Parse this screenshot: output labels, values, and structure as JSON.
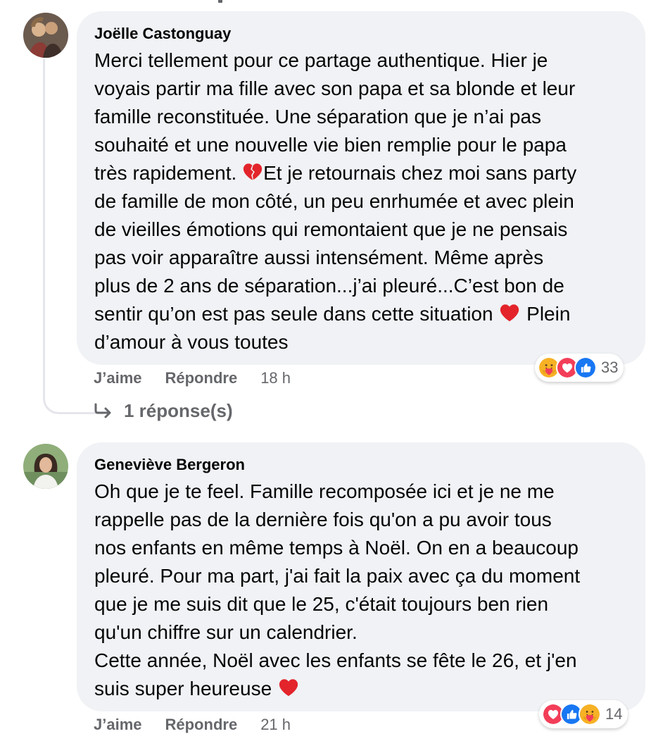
{
  "comments": [
    {
      "author": "Joëlle Castonguay",
      "text": [
        "Merci tellement pour ce partage authentique. Hier je",
        "voyais partir ma fille avec son papa et sa blonde et leur",
        "famille reconstituée. Une séparation que je n’ai pas",
        "souhaité et une nouvelle vie bien remplie pour le papa",
        "très rapidement. ",
        "Et je retournais chez moi sans party",
        "de famille de mon côté, un peu enrhumée et avec plein",
        "de vieilles émotions qui remontaient que je ne pensais",
        "pas voir apparaître aussi intensément. Même après",
        "plus de 2 ans de séparation...j’ai pleuré...C’est bon de",
        "sentir qu’on est pas seule dans cette situation ",
        " Plein",
        "d’amour à vous toutes"
      ],
      "reactions": {
        "icons": [
          "care-icon",
          "love-icon",
          "like-icon"
        ],
        "count": "33"
      },
      "like_label": "J’aime",
      "reply_label": "Répondre",
      "time": "18 h",
      "replies_label": "1 réponse(s)"
    },
    {
      "author": "Geneviève Bergeron",
      "text": [
        "Oh que je te feel. Famille recomposée ici et je ne me",
        "rappelle pas de la dernière fois qu'on a pu avoir tous",
        "nos enfants en même temps à Noël. On en a beaucoup",
        "pleuré. Pour ma part, j'ai fait la paix avec ça du moment",
        "que je me suis dit que le 25, c'était toujours ben rien",
        "qu'un chiffre sur un calendrier.",
        "Cette année, Noël avec les enfants se fête le 26, et j'en",
        "suis super heureuse "
      ],
      "reactions": {
        "icons": [
          "love-icon",
          "like-icon",
          "care-icon"
        ],
        "count": "14"
      },
      "like_label": "J’aime",
      "reply_label": "Répondre",
      "time": "21 h"
    }
  ],
  "colors": {
    "bubble": "#f0f2f5",
    "secondary_text": "#65676b",
    "like_blue": "#1877f2",
    "love_red": "#f33e58",
    "care_yellow": "#f7b125"
  }
}
